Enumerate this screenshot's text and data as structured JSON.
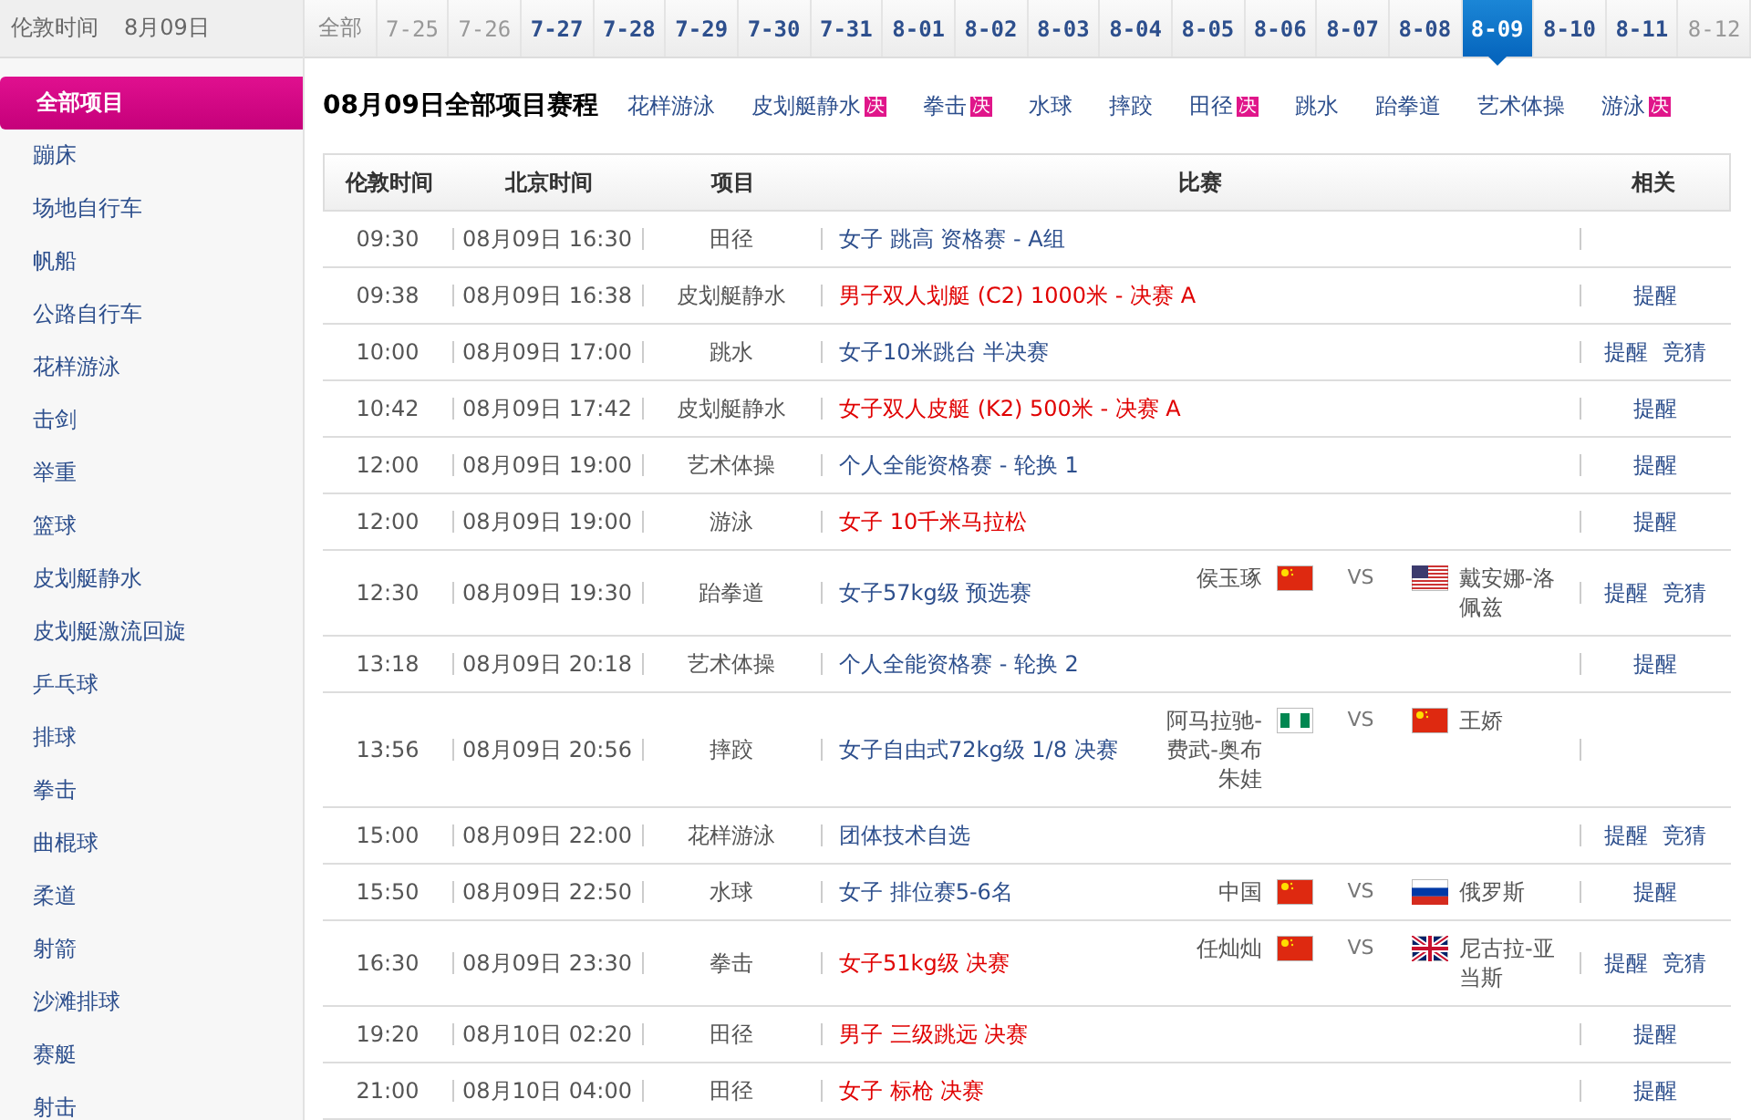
{
  "clock": {
    "label": "伦敦时间",
    "date": "8月09日"
  },
  "date_tabs": [
    {
      "label": "全部",
      "selected": false,
      "disabled": false,
      "kind": "all"
    },
    {
      "label": "7-25",
      "selected": false,
      "disabled": true,
      "kind": "date"
    },
    {
      "label": "7-26",
      "selected": false,
      "disabled": true,
      "kind": "date"
    },
    {
      "label": "7-27",
      "selected": false,
      "disabled": false,
      "kind": "date"
    },
    {
      "label": "7-28",
      "selected": false,
      "disabled": false,
      "kind": "date"
    },
    {
      "label": "7-29",
      "selected": false,
      "disabled": false,
      "kind": "date"
    },
    {
      "label": "7-30",
      "selected": false,
      "disabled": false,
      "kind": "date"
    },
    {
      "label": "7-31",
      "selected": false,
      "disabled": false,
      "kind": "date"
    },
    {
      "label": "8-01",
      "selected": false,
      "disabled": false,
      "kind": "date"
    },
    {
      "label": "8-02",
      "selected": false,
      "disabled": false,
      "kind": "date"
    },
    {
      "label": "8-03",
      "selected": false,
      "disabled": false,
      "kind": "date"
    },
    {
      "label": "8-04",
      "selected": false,
      "disabled": false,
      "kind": "date"
    },
    {
      "label": "8-05",
      "selected": false,
      "disabled": false,
      "kind": "date"
    },
    {
      "label": "8-06",
      "selected": false,
      "disabled": false,
      "kind": "date"
    },
    {
      "label": "8-07",
      "selected": false,
      "disabled": false,
      "kind": "date"
    },
    {
      "label": "8-08",
      "selected": false,
      "disabled": false,
      "kind": "date"
    },
    {
      "label": "8-09",
      "selected": true,
      "disabled": false,
      "kind": "date"
    },
    {
      "label": "8-10",
      "selected": false,
      "disabled": false,
      "kind": "date"
    },
    {
      "label": "8-11",
      "selected": false,
      "disabled": false,
      "kind": "date"
    },
    {
      "label": "8-12",
      "selected": false,
      "disabled": true,
      "kind": "date"
    }
  ],
  "sidebar": {
    "items": [
      {
        "label": "全部项目",
        "selected": true
      },
      {
        "label": "蹦床",
        "selected": false
      },
      {
        "label": "场地自行车",
        "selected": false
      },
      {
        "label": "帆船",
        "selected": false
      },
      {
        "label": "公路自行车",
        "selected": false
      },
      {
        "label": "花样游泳",
        "selected": false
      },
      {
        "label": "击剑",
        "selected": false
      },
      {
        "label": "举重",
        "selected": false
      },
      {
        "label": "篮球",
        "selected": false
      },
      {
        "label": "皮划艇静水",
        "selected": false
      },
      {
        "label": "皮划艇激流回旋",
        "selected": false
      },
      {
        "label": "乒乓球",
        "selected": false
      },
      {
        "label": "排球",
        "selected": false
      },
      {
        "label": "拳击",
        "selected": false
      },
      {
        "label": "曲棍球",
        "selected": false
      },
      {
        "label": "柔道",
        "selected": false
      },
      {
        "label": "射箭",
        "selected": false
      },
      {
        "label": "沙滩排球",
        "selected": false
      },
      {
        "label": "赛艇",
        "selected": false
      },
      {
        "label": "射击",
        "selected": false
      }
    ]
  },
  "heading": "08月09日全部项目赛程",
  "sport_links": [
    {
      "label": "花样游泳"
    },
    {
      "label": "皮划艇静水",
      "badge": "决"
    },
    {
      "label": "拳击",
      "badge": "决"
    },
    {
      "label": "水球"
    },
    {
      "label": "摔跤"
    },
    {
      "label": "田径",
      "badge": "决"
    },
    {
      "label": "跳水"
    },
    {
      "label": "跆拳道"
    },
    {
      "label": "艺术体操"
    },
    {
      "label": "游泳",
      "badge": "决"
    }
  ],
  "table": {
    "columns": [
      "伦敦时间",
      "北京时间",
      "项目",
      "比赛",
      "相关"
    ],
    "rows": [
      {
        "london": "09:30",
        "beijing": "08月09日 16:30",
        "sport": "田径",
        "match": "女子 跳高 资格赛 - A组",
        "final": false
      },
      {
        "london": "09:38",
        "beijing": "08月09日 16:38",
        "sport": "皮划艇静水",
        "match": "男子双人划艇 (C2) 1000米 - 决赛 A",
        "final": true,
        "actions": [
          "提醒"
        ]
      },
      {
        "london": "10:00",
        "beijing": "08月09日 17:00",
        "sport": "跳水",
        "match": "女子10米跳台 半决赛",
        "final": false,
        "actions": [
          "提醒",
          "竞猜"
        ]
      },
      {
        "london": "10:42",
        "beijing": "08月09日 17:42",
        "sport": "皮划艇静水",
        "match": "女子双人皮艇 (K2) 500米 - 决赛 A",
        "final": true,
        "actions": [
          "提醒"
        ]
      },
      {
        "london": "12:00",
        "beijing": "08月09日 19:00",
        "sport": "艺术体操",
        "match": "个人全能资格赛 - 轮换 1",
        "final": false,
        "actions": [
          "提醒"
        ]
      },
      {
        "london": "12:00",
        "beijing": "08月09日 19:00",
        "sport": "游泳",
        "match": "女子 10千米马拉松",
        "final": true,
        "actions": [
          "提醒"
        ]
      },
      {
        "london": "12:30",
        "beijing": "08月09日 19:30",
        "sport": "跆拳道",
        "match": "女子57kg级 预选赛",
        "final": false,
        "matchup": {
          "left": "侯玉琢",
          "left_flag": {
            "kind": "china"
          },
          "vs": "VS",
          "right_flag": {
            "kind": "usa"
          },
          "right": "戴安娜-洛佩兹"
        },
        "actions": [
          "提醒",
          "竞猜"
        ]
      },
      {
        "london": "13:18",
        "beijing": "08月09日 20:18",
        "sport": "艺术体操",
        "match": "个人全能资格赛 - 轮换 2",
        "final": false,
        "actions": [
          "提醒"
        ]
      },
      {
        "london": "13:56",
        "beijing": "08月09日 20:56",
        "sport": "摔跤",
        "match": "女子自由式72kg级 1/8 决赛",
        "final": false,
        "matchup": {
          "left": "阿马拉驰-费武-奥布朱娃",
          "left_flag": {
            "kind": "nigeria"
          },
          "vs": "VS",
          "right_flag": {
            "kind": "china"
          },
          "right": "王娇"
        }
      },
      {
        "london": "15:00",
        "beijing": "08月09日 22:00",
        "sport": "花样游泳",
        "match": "团体技术自选",
        "final": false,
        "actions": [
          "提醒",
          "竞猜"
        ]
      },
      {
        "london": "15:50",
        "beijing": "08月09日 22:50",
        "sport": "水球",
        "match": "女子 排位赛5-6名",
        "final": false,
        "matchup": {
          "left": "中国",
          "left_flag": {
            "kind": "china"
          },
          "vs": "VS",
          "right_flag": {
            "kind": "russia"
          },
          "right": "俄罗斯"
        },
        "actions": [
          "提醒"
        ]
      },
      {
        "london": "16:30",
        "beijing": "08月09日 23:30",
        "sport": "拳击",
        "match": "女子51kg级 决赛",
        "final": true,
        "matchup": {
          "left": "任灿灿",
          "left_flag": {
            "kind": "china"
          },
          "vs": "VS",
          "right_flag": {
            "kind": "uk"
          },
          "right": "尼古拉-亚当斯"
        },
        "actions": [
          "提醒",
          "竞猜"
        ]
      },
      {
        "london": "19:20",
        "beijing": "08月10日 02:20",
        "sport": "田径",
        "match": "男子 三级跳远 决赛",
        "final": true,
        "actions": [
          "提醒"
        ]
      },
      {
        "london": "21:00",
        "beijing": "08月10日 04:00",
        "sport": "田径",
        "match": "女子 标枪 决赛",
        "final": true,
        "actions": [
          "提醒"
        ]
      }
    ]
  }
}
